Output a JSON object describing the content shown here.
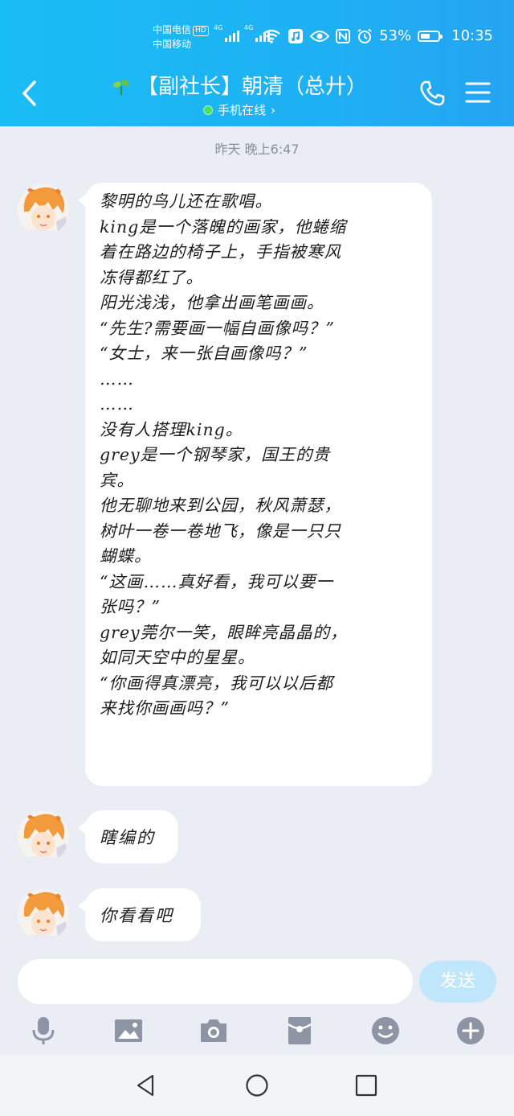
{
  "status_bar": {
    "carrier1": "中国电信",
    "hd_badge": "HD",
    "carrier2": "中国移动",
    "network1": "4G",
    "network2": "4G",
    "battery_percent_text": "53%",
    "battery_level": 0.53,
    "time": "10:35"
  },
  "header": {
    "title": "【副社长】朝清（总廾）",
    "subtitle": "手机在线",
    "subtitle_arrow": "›"
  },
  "chat": {
    "timestamp": "昨天 晚上6:47",
    "messages": [
      {
        "lines": [
          "黎明的鸟儿还在歌唱。",
          "king是一个落魄的画家，他蜷缩",
          "着在路边的椅子上，手指被寒风",
          "冻得都红了。",
          "阳光浅浅，他拿出画笔画画。",
          "“先生?需要画一幅自画像吗？”",
          "“女士，来一张自画像吗？”",
          "……",
          "……",
          "没有人搭理king。",
          "grey是一个钢琴家，国王的贵",
          "宾。",
          "他无聊地来到公园，秋风萧瑟，",
          "树叶一卷一卷地飞，像是一只只",
          "蝴蝶。",
          "“这画……真好看，我可以要一",
          "张吗？”",
          "grey莞尔一笑，眼眸亮晶晶的，",
          "如同天空中的星星。",
          "“你画得真漂亮，我可以以后都",
          "来找你画画吗？”"
        ]
      },
      {
        "text": "瞎编的"
      },
      {
        "text": "你看看吧"
      }
    ]
  },
  "input": {
    "value": "",
    "send_label": "发送"
  },
  "toolbar": {
    "icons": [
      "microphone-icon",
      "image-icon",
      "camera-icon",
      "red-packet-icon",
      "emoji-icon",
      "plus-icon"
    ]
  },
  "colors": {
    "header_start": "#19bdf5",
    "header_end": "#25a4f2",
    "chat_background": "#eaedf4",
    "bubble": "#ffffff",
    "send_button": "#bfe6fb",
    "toolbar_icon": "#8d95a5",
    "online_dot": "#4bde63"
  }
}
